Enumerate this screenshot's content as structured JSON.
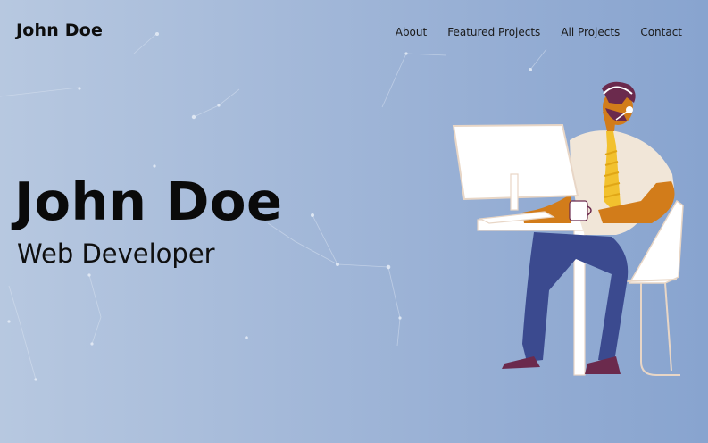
{
  "header": {
    "brand": "John Doe"
  },
  "nav": {
    "items": [
      {
        "label": "About"
      },
      {
        "label": "Featured Projects"
      },
      {
        "label": "All Projects"
      },
      {
        "label": "Contact"
      }
    ]
  },
  "hero": {
    "name": "John Doe",
    "role": "Web Developer",
    "illustration_icon": "developer-at-computer-illustration"
  },
  "colors": {
    "background_start": "#b7c8e0",
    "background_end": "#88a4cf",
    "text": "#0a0a0a",
    "accent_orange": "#d27c1a",
    "accent_navy": "#3b4a8f",
    "tie_yellow": "#f2c12e"
  }
}
